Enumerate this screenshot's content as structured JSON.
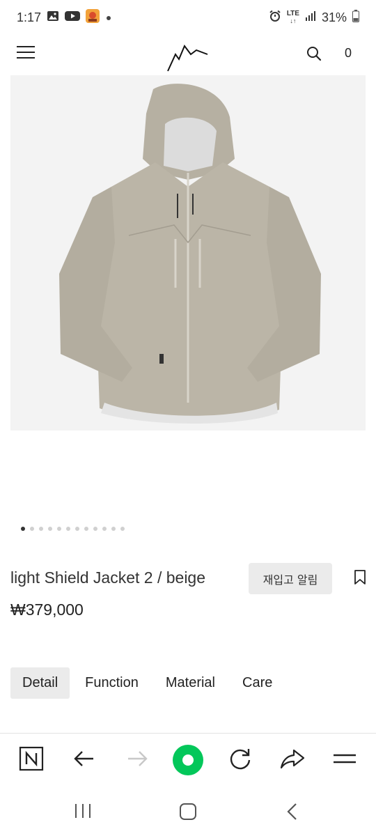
{
  "status_bar": {
    "time": "1:17",
    "network": "LTE",
    "battery": "31%",
    "icons": [
      "image-icon",
      "youtube-icon",
      "app-icon",
      "dot-icon",
      "alarm-icon",
      "lte-icon",
      "signal-icon",
      "battery-icon"
    ]
  },
  "header": {
    "logo_name": "mountain-logo-icon",
    "cart_count": "0"
  },
  "product": {
    "title": "light Shield Jacket 2 / beige",
    "price": "₩379,000",
    "restock_label": "재입고 알림",
    "image_count": 12,
    "active_image": 1
  },
  "tabs": [
    {
      "label": "Detail",
      "active": true
    },
    {
      "label": "Function",
      "active": false
    },
    {
      "label": "Material",
      "active": false
    },
    {
      "label": "Care",
      "active": false
    }
  ],
  "colors": {
    "accent_green": "#03c75a",
    "jacket": "#b9b3a5",
    "tab_active_bg": "#ebebeb"
  }
}
